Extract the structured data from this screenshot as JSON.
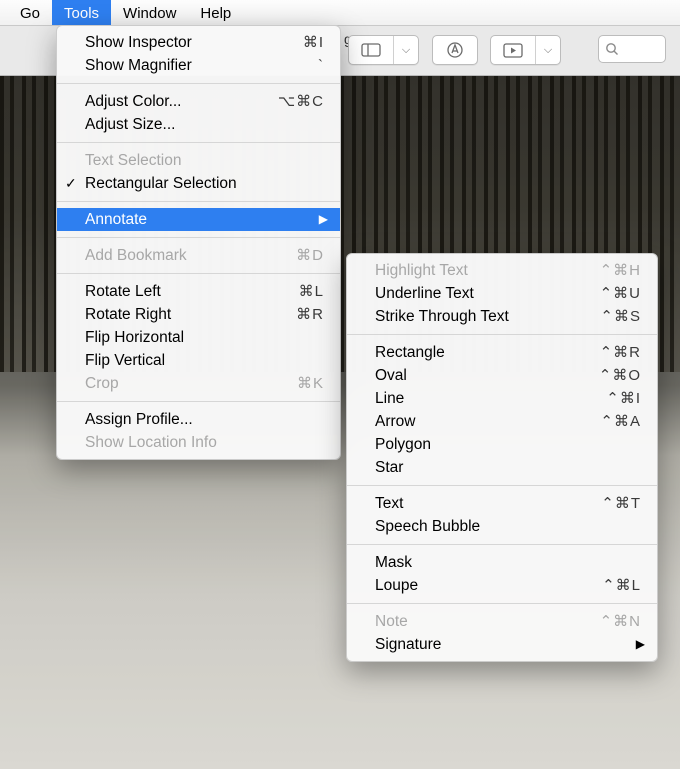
{
  "menubar": {
    "items": [
      {
        "label": "Go"
      },
      {
        "label": "Tools"
      },
      {
        "label": "Window"
      },
      {
        "label": "Help"
      }
    ],
    "selected_index": 1
  },
  "toolbar": {
    "truncated_text": "g",
    "search_placeholder": ""
  },
  "tools_menu": {
    "groups": [
      [
        {
          "label": "Show Inspector",
          "shortcut": "⌘I"
        },
        {
          "label": "Show Magnifier",
          "shortcut": "`"
        }
      ],
      [
        {
          "label": "Adjust Color...",
          "shortcut": "⌥⌘C"
        },
        {
          "label": "Adjust Size...",
          "shortcut": ""
        }
      ],
      [
        {
          "label": "Text Selection",
          "shortcut": "",
          "disabled": true
        },
        {
          "label": "Rectangular Selection",
          "shortcut": "",
          "checked": true
        }
      ],
      [
        {
          "label": "Annotate",
          "shortcut": "",
          "submenu": true,
          "highlight": true
        }
      ],
      [
        {
          "label": "Add Bookmark",
          "shortcut": "⌘D",
          "disabled": true
        }
      ],
      [
        {
          "label": "Rotate Left",
          "shortcut": "⌘L"
        },
        {
          "label": "Rotate Right",
          "shortcut": "⌘R"
        },
        {
          "label": "Flip Horizontal",
          "shortcut": ""
        },
        {
          "label": "Flip Vertical",
          "shortcut": ""
        },
        {
          "label": "Crop",
          "shortcut": "⌘K",
          "disabled": true
        }
      ],
      [
        {
          "label": "Assign Profile...",
          "shortcut": ""
        },
        {
          "label": "Show Location Info",
          "shortcut": "",
          "disabled": true
        }
      ]
    ]
  },
  "annotate_menu": {
    "groups": [
      [
        {
          "label": "Highlight Text",
          "shortcut": "⌃⌘H",
          "disabled": true
        },
        {
          "label": "Underline Text",
          "shortcut": "⌃⌘U"
        },
        {
          "label": "Strike Through Text",
          "shortcut": "⌃⌘S"
        }
      ],
      [
        {
          "label": "Rectangle",
          "shortcut": "⌃⌘R"
        },
        {
          "label": "Oval",
          "shortcut": "⌃⌘O"
        },
        {
          "label": "Line",
          "shortcut": "⌃⌘I"
        },
        {
          "label": "Arrow",
          "shortcut": "⌃⌘A"
        },
        {
          "label": "Polygon",
          "shortcut": ""
        },
        {
          "label": "Star",
          "shortcut": ""
        }
      ],
      [
        {
          "label": "Text",
          "shortcut": "⌃⌘T"
        },
        {
          "label": "Speech Bubble",
          "shortcut": ""
        }
      ],
      [
        {
          "label": "Mask",
          "shortcut": ""
        },
        {
          "label": "Loupe",
          "shortcut": "⌃⌘L"
        }
      ],
      [
        {
          "label": "Note",
          "shortcut": "⌃⌘N",
          "disabled": true
        },
        {
          "label": "Signature",
          "shortcut": "",
          "submenu": true
        }
      ]
    ]
  }
}
